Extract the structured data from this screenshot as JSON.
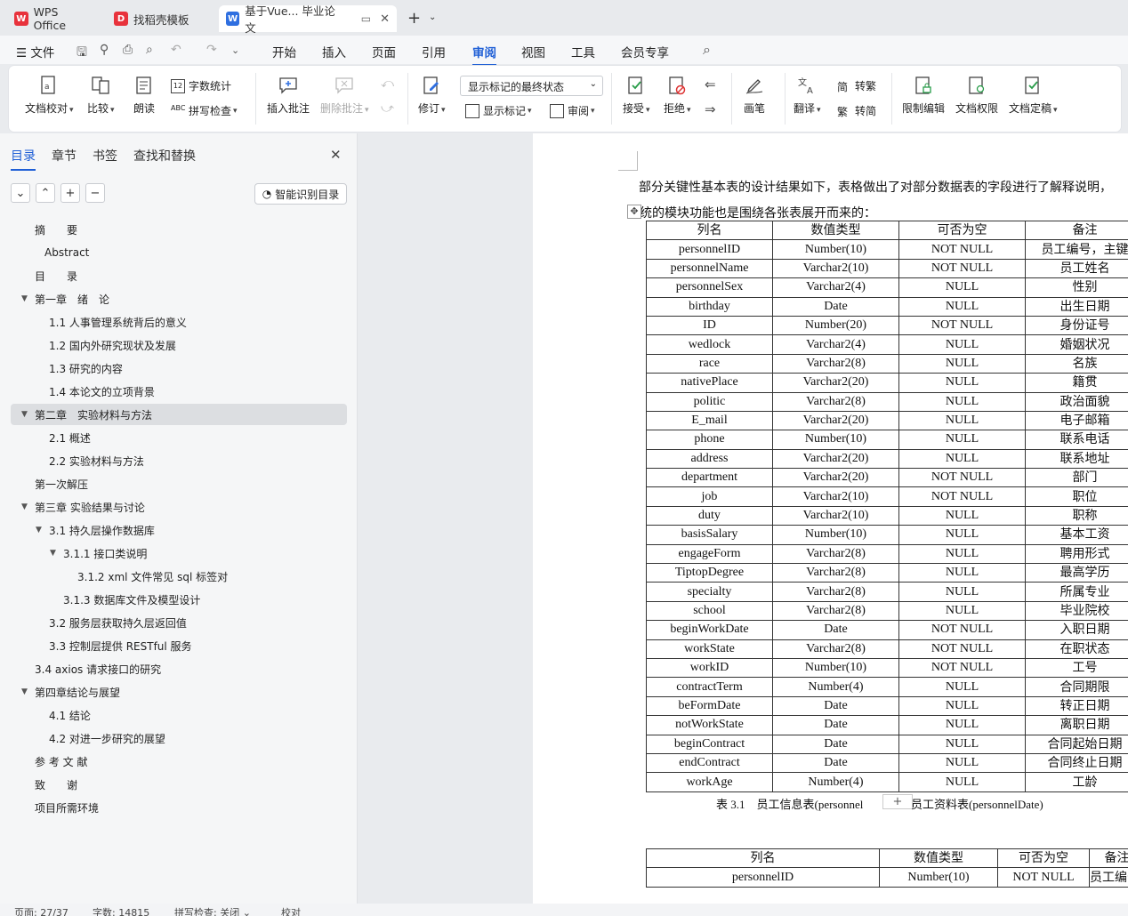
{
  "tabs": [
    {
      "label": "WPS Office",
      "icon": "wps-logo-icon"
    },
    {
      "label": "找稻壳模板",
      "icon": "docer-icon"
    },
    {
      "label": "基于Vue... 毕业论文",
      "icon": "word-doc-icon",
      "active": true
    }
  ],
  "menu": {
    "file": "文件",
    "items": [
      "开始",
      "插入",
      "页面",
      "引用",
      "审阅",
      "视图",
      "工具",
      "会员专享"
    ],
    "active": "审阅"
  },
  "ribbon": {
    "doc_check": "文档校对",
    "compare": "比较",
    "read_aloud": "朗读",
    "word_count": "字数统计",
    "spell_check": "拼写检查",
    "insert_comment": "插入批注",
    "delete_comment": "删除批注",
    "revise": "修订",
    "markup_select": "显示标记的最终状态",
    "show_markup": "显示标记",
    "review": "审阅",
    "accept": "接受",
    "reject": "拒绝",
    "pen": "画笔",
    "translate": "翻译",
    "to_traditional": "转繁",
    "to_simplified": "转简",
    "restrict_edit": "限制编辑",
    "doc_permission": "文档权限",
    "finalize": "文档定稿"
  },
  "panel": {
    "tabs": [
      "目录",
      "章节",
      "书签",
      "查找和替换"
    ],
    "smart_toc": "智能识别目录",
    "toc": [
      {
        "text": "摘　　要",
        "level": 1
      },
      {
        "text": "Abstract",
        "level": 1.4
      },
      {
        "text": "目　　录",
        "level": 1
      },
      {
        "text": "第一章　绪　论",
        "level": 1,
        "arrow": true
      },
      {
        "text": "1.1  人事管理系统背后的意义",
        "level": 2
      },
      {
        "text": "1.2  国内外研究现状及发展",
        "level": 2
      },
      {
        "text": "1.3  研究的内容",
        "level": 2
      },
      {
        "text": "1.4  本论文的立项背景",
        "level": 2
      },
      {
        "text": "第二章　实验材料与方法",
        "level": 1,
        "arrow": true,
        "selected": true
      },
      {
        "text": "2.1  概述",
        "level": 2
      },
      {
        "text": "2.2  实验材料与方法",
        "level": 2
      },
      {
        "text": "第一次解压",
        "level": 1
      },
      {
        "text": "第三章  实验结果与讨论",
        "level": 1,
        "arrow": true
      },
      {
        "text": "3.1  持久层操作数据库",
        "level": 2,
        "arrow": true
      },
      {
        "text": "3.1.1  接口类说明",
        "level": 3,
        "arrow": true
      },
      {
        "text": "3.1.2    xml 文件常见 sql 标签对",
        "level": 4
      },
      {
        "text": "3.1.3     数据库文件及模型设计",
        "level": 3
      },
      {
        "text": "3.2  服务层获取持久层返回值",
        "level": 2
      },
      {
        "text": "3.3  控制层提供 RESTful 服务",
        "level": 2
      },
      {
        "text": "3.4 axios 请求接口的研究",
        "level": 1
      },
      {
        "text": "第四章结论与展望",
        "level": 1,
        "arrow": true
      },
      {
        "text": "4.1  结论",
        "level": 2
      },
      {
        "text": "4.2  对进一步研究的展望",
        "level": 2
      },
      {
        "text": "参 考 文 献",
        "level": 1
      },
      {
        "text": "致　　谢",
        "level": 1
      },
      {
        "text": "项目所需环境",
        "level": 1
      }
    ]
  },
  "doc": {
    "para_line1": "部分关键性基本表的设计结果如下，表格做出了对部分数据表的字段进行了解释说明，",
    "para_line2": "系统的模块功能也是围绕各张表展开而来的：",
    "table1": {
      "headers": [
        "列名",
        "数值类型",
        "可否为空",
        "备注"
      ],
      "rows": [
        [
          "personnelID",
          "Number(10)",
          "NOT NULL",
          "员工编号，主键"
        ],
        [
          "personnelName",
          "Varchar2(10)",
          "NOT NULL",
          "员工姓名"
        ],
        [
          "personnelSex",
          "Varchar2(4)",
          "NULL",
          "性别"
        ],
        [
          "birthday",
          "Date",
          "NULL",
          "出生日期"
        ],
        [
          "ID",
          "Number(20)",
          "NOT NULL",
          "身份证号"
        ],
        [
          "wedlock",
          "Varchar2(4)",
          "NULL",
          "婚姻状况"
        ],
        [
          "race",
          "Varchar2(8)",
          "NULL",
          "名族"
        ],
        [
          "nativePlace",
          "Varchar2(20)",
          "NULL",
          "籍贯"
        ],
        [
          "politic",
          "Varchar2(8)",
          "NULL",
          "政治面貌"
        ],
        [
          "E_mail",
          "Varchar2(20)",
          "NULL",
          "电子邮箱"
        ],
        [
          "phone",
          "Number(10)",
          "NULL",
          "联系电话"
        ],
        [
          "address",
          "Varchar2(20)",
          "NULL",
          "联系地址"
        ],
        [
          "department",
          "Varchar2(20)",
          "NOT NULL",
          "部门"
        ],
        [
          "job",
          "Varchar2(10)",
          "NOT NULL",
          "职位"
        ],
        [
          "duty",
          "Varchar2(10)",
          "NULL",
          "职称"
        ],
        [
          "basisSalary",
          "Number(10)",
          "NULL",
          "基本工资"
        ],
        [
          "engageForm",
          "Varchar2(8)",
          "NULL",
          "聘用形式"
        ],
        [
          "TiptopDegree",
          "Varchar2(8)",
          "NULL",
          "最高学历"
        ],
        [
          "specialty",
          "Varchar2(8)",
          "NULL",
          "所属专业"
        ],
        [
          "school",
          "Varchar2(8)",
          "NULL",
          "毕业院校"
        ],
        [
          "beginWorkDate",
          "Date",
          "NOT NULL",
          "入职日期"
        ],
        [
          "workState",
          "Varchar2(8)",
          "NOT NULL",
          "在职状态"
        ],
        [
          "workID",
          "Number(10)",
          "NOT NULL",
          "工号"
        ],
        [
          "contractTerm",
          "Number(4)",
          "NULL",
          "合同期限"
        ],
        [
          "beFormDate",
          "Date",
          "NULL",
          "转正日期"
        ],
        [
          "notWorkState",
          "Date",
          "NULL",
          "离职日期"
        ],
        [
          "beginContract",
          "Date",
          "NULL",
          "合同起始日期"
        ],
        [
          "endContract",
          "Date",
          "NULL",
          "合同终止日期"
        ],
        [
          "workAge",
          "Number(4)",
          "NULL",
          "工龄"
        ]
      ]
    },
    "caption_left": "表 3.1　员工信息表(personnel",
    "caption_right": "员工资料表(personnelDate)",
    "table2": {
      "headers": [
        "列名",
        "数值类型",
        "可否为空",
        "备注"
      ],
      "rows": [
        [
          "personnelID",
          "Number(10)",
          "NOT NULL",
          "员工编号，主"
        ]
      ]
    }
  },
  "status": {
    "page": "页面: 27/37",
    "words": "字数: 14815",
    "spell": "拼写检查: 关闭",
    "proof": "校对"
  }
}
